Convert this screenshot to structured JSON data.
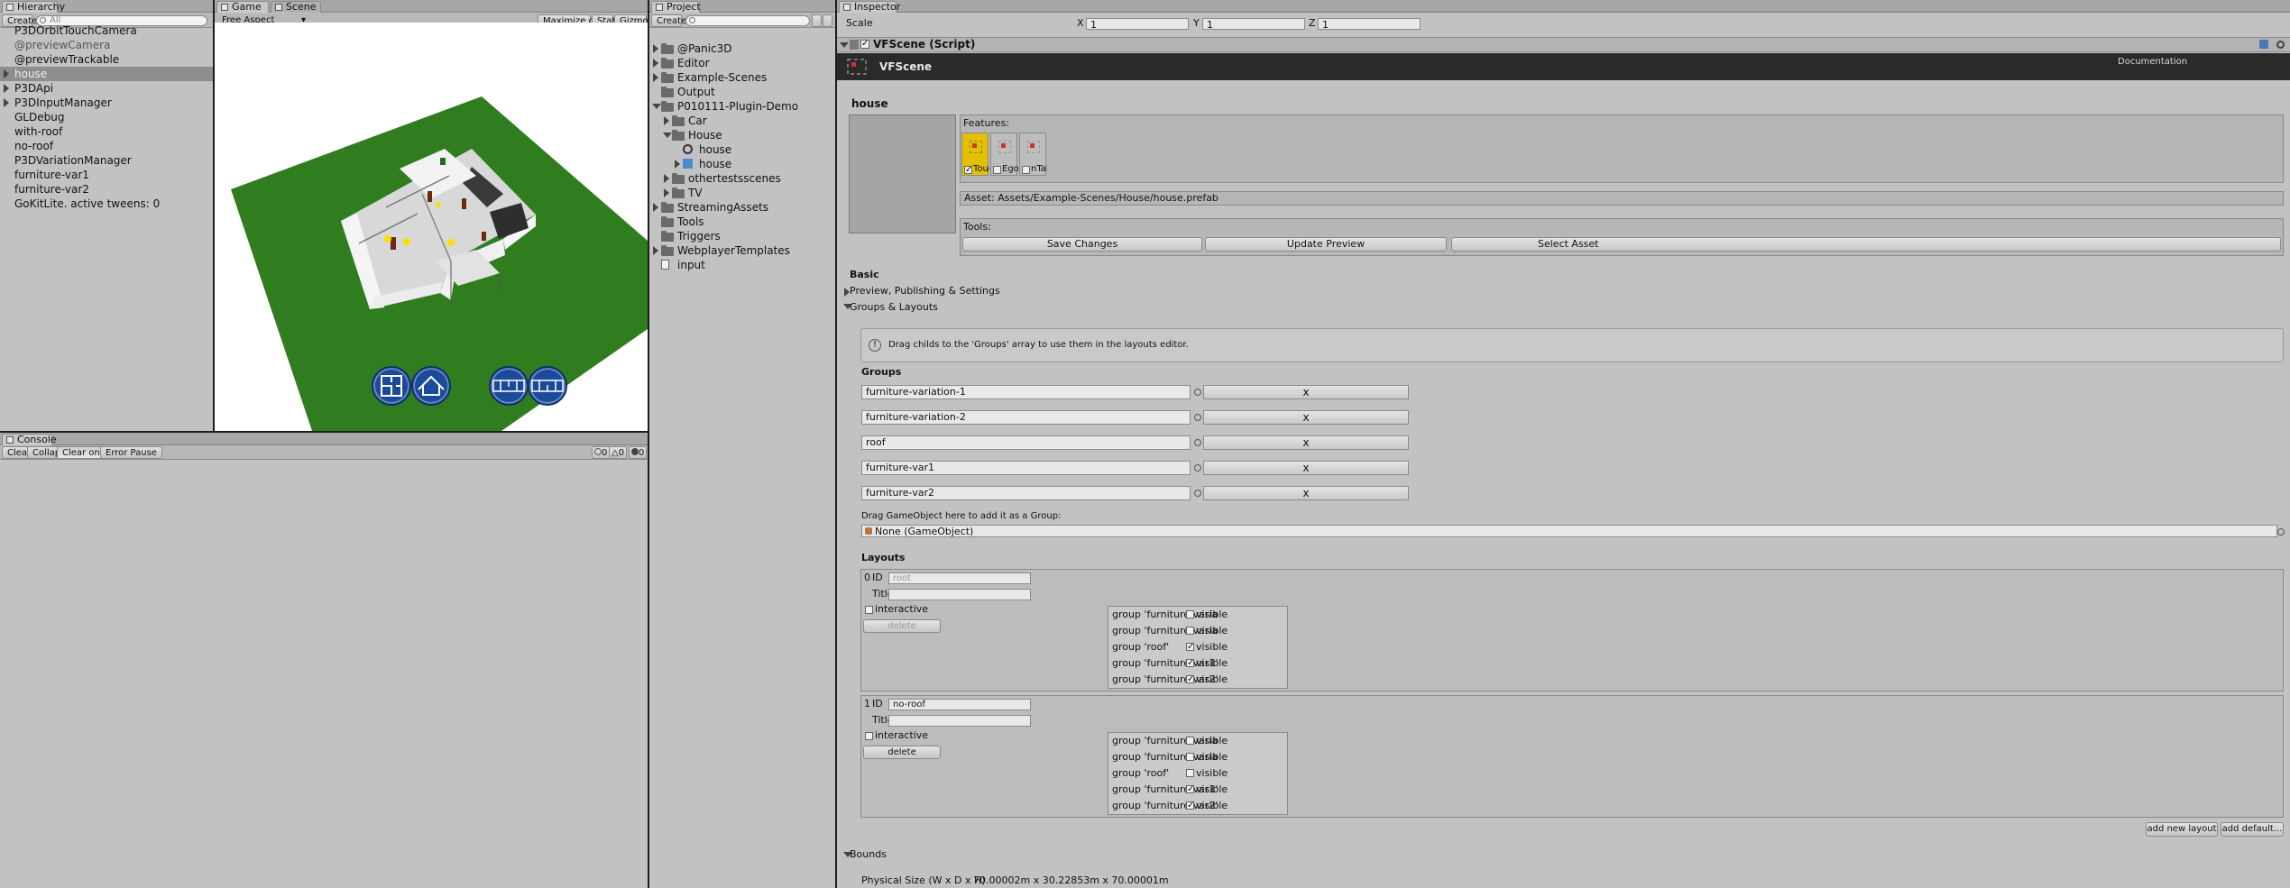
{
  "hierarchy": {
    "tab": "Hierarchy",
    "create": "Create",
    "search_placeholder": "All",
    "items": [
      {
        "label": "P3DOrbitTouchCamera",
        "dim": false
      },
      {
        "label": "@previewCamera",
        "dim": true
      },
      {
        "label": "@previewTrackable",
        "dim": false
      },
      {
        "label": "house",
        "dim": false,
        "selected": true,
        "arrow": true
      },
      {
        "label": "P3DApi",
        "dim": false,
        "arrow": true
      },
      {
        "label": "P3DInputManager",
        "dim": false,
        "arrow": true
      },
      {
        "label": "GLDebug",
        "dim": false
      },
      {
        "label": "with-roof",
        "dim": false
      },
      {
        "label": "no-roof",
        "dim": false
      },
      {
        "label": "P3DVariationManager",
        "dim": false
      },
      {
        "label": "furniture-var1",
        "dim": false
      },
      {
        "label": "furniture-var2",
        "dim": false
      },
      {
        "label": "GoKitLite. active tweens: 0",
        "dim": false
      }
    ]
  },
  "game": {
    "tab_game": "Game",
    "tab_scene": "Scene",
    "aspect": "Free Aspect",
    "maximize": "Maximize on Play",
    "stats": "Stats",
    "gizmos": "Gizmos",
    "ground_color": "#2f7d1f",
    "button_color": "#1c4a9a"
  },
  "console": {
    "tab": "Console",
    "clear": "Clear",
    "collapse": "Collapse",
    "clear_on_play": "Clear on Play",
    "error_pause": "Error Pause",
    "count_info": "0",
    "count_warn": "0",
    "count_error": "0"
  },
  "project": {
    "tab": "Project",
    "create": "Create",
    "items": [
      {
        "label": "@Panic3D",
        "indent": 0,
        "arrow": "right",
        "kind": "folder"
      },
      {
        "label": "Editor",
        "indent": 0,
        "arrow": "right",
        "kind": "folder"
      },
      {
        "label": "Example-Scenes",
        "indent": 0,
        "arrow": "right",
        "kind": "folder"
      },
      {
        "label": "Output",
        "indent": 0,
        "arrow": "",
        "kind": "folder"
      },
      {
        "label": "P010111-Plugin-Demo",
        "indent": 0,
        "arrow": "down",
        "kind": "folder"
      },
      {
        "label": "Car",
        "indent": 1,
        "arrow": "right",
        "kind": "folder"
      },
      {
        "label": "House",
        "indent": 1,
        "arrow": "down",
        "kind": "folder"
      },
      {
        "label": "house",
        "indent": 2,
        "arrow": "",
        "kind": "scene"
      },
      {
        "label": "house",
        "indent": 2,
        "arrow": "right",
        "kind": "prefab"
      },
      {
        "label": "othertestsscenes",
        "indent": 1,
        "arrow": "right",
        "kind": "folder"
      },
      {
        "label": "TV",
        "indent": 1,
        "arrow": "right",
        "kind": "folder"
      },
      {
        "label": "StreamingAssets",
        "indent": 0,
        "arrow": "right",
        "kind": "folder"
      },
      {
        "label": "Tools",
        "indent": 0,
        "arrow": "",
        "kind": "folder"
      },
      {
        "label": "Triggers",
        "indent": 0,
        "arrow": "",
        "kind": "folder"
      },
      {
        "label": "WebplayerTemplates",
        "indent": 0,
        "arrow": "right",
        "kind": "folder"
      },
      {
        "label": "input",
        "indent": 0,
        "arrow": "",
        "kind": "file"
      }
    ]
  },
  "inspector": {
    "tab": "Inspector",
    "scale_label": "Scale",
    "scale_x_label": "X",
    "scale_x": "1",
    "scale_y_label": "Y",
    "scale_y": "1",
    "scale_z_label": "Z",
    "scale_z": "1",
    "component_title": "VFScene (Script)",
    "banner_title": "VFScene",
    "documentation": "Documentation",
    "object_name": "house",
    "features_label": "Features:",
    "features": [
      {
        "label": "Touch",
        "checked": true,
        "active": true
      },
      {
        "label": "Ego",
        "checked": false,
        "active": false
      },
      {
        "label": "nTable",
        "checked": false,
        "active": false
      }
    ],
    "asset_path": "Asset: Assets/Example-Scenes/House/house.prefab",
    "tools_label": "Tools:",
    "save_changes": "Save Changes",
    "update_preview": "Update Preview",
    "select_asset": "Select Asset",
    "basic": "Basic",
    "preview_publishing": "Preview, Publishing & Settings",
    "groups_layouts": "Groups & Layouts",
    "info_text": "Drag childs to the 'Groups' array to use them in the layouts editor.",
    "groups_heading": "Groups",
    "groups": [
      "furniture-variation-1",
      "furniture-variation-2",
      "roof",
      "furniture-var1",
      "furniture-var2"
    ],
    "remove_label": "x",
    "drag_label": "Drag GameObject here to add it as a Group:",
    "drag_field": "None (GameObject)",
    "layouts_heading": "Layouts",
    "id_label": "ID",
    "title_label": "Title",
    "interactive_label": "interactive",
    "delete_label": "delete",
    "visible_label": "visible",
    "layouts": [
      {
        "index": "0",
        "id": "root",
        "rows": [
          {
            "group": "group 'furniture-varia",
            "visible": false
          },
          {
            "group": "group 'furniture-varia",
            "visible": false
          },
          {
            "group": "group 'roof'",
            "visible": true
          },
          {
            "group": "group 'furniture-var1'",
            "visible": true
          },
          {
            "group": "group 'furniture-var2'",
            "visible": true
          }
        ]
      },
      {
        "index": "1",
        "id": "no-roof",
        "rows": [
          {
            "group": "group 'furniture-varia",
            "visible": false
          },
          {
            "group": "group 'furniture-varia",
            "visible": false
          },
          {
            "group": "group 'roof'",
            "visible": false
          },
          {
            "group": "group 'furniture-var1'",
            "visible": true
          },
          {
            "group": "group 'furniture-var2'",
            "visible": true
          }
        ]
      }
    ],
    "add_new_layout": "add new layout",
    "add_default": "add default...",
    "bounds": "Bounds",
    "physical_size_label": "Physical Size (W x D x H)",
    "physical_size_value": "70.00002m x 30.22853m x 70.00001m"
  }
}
